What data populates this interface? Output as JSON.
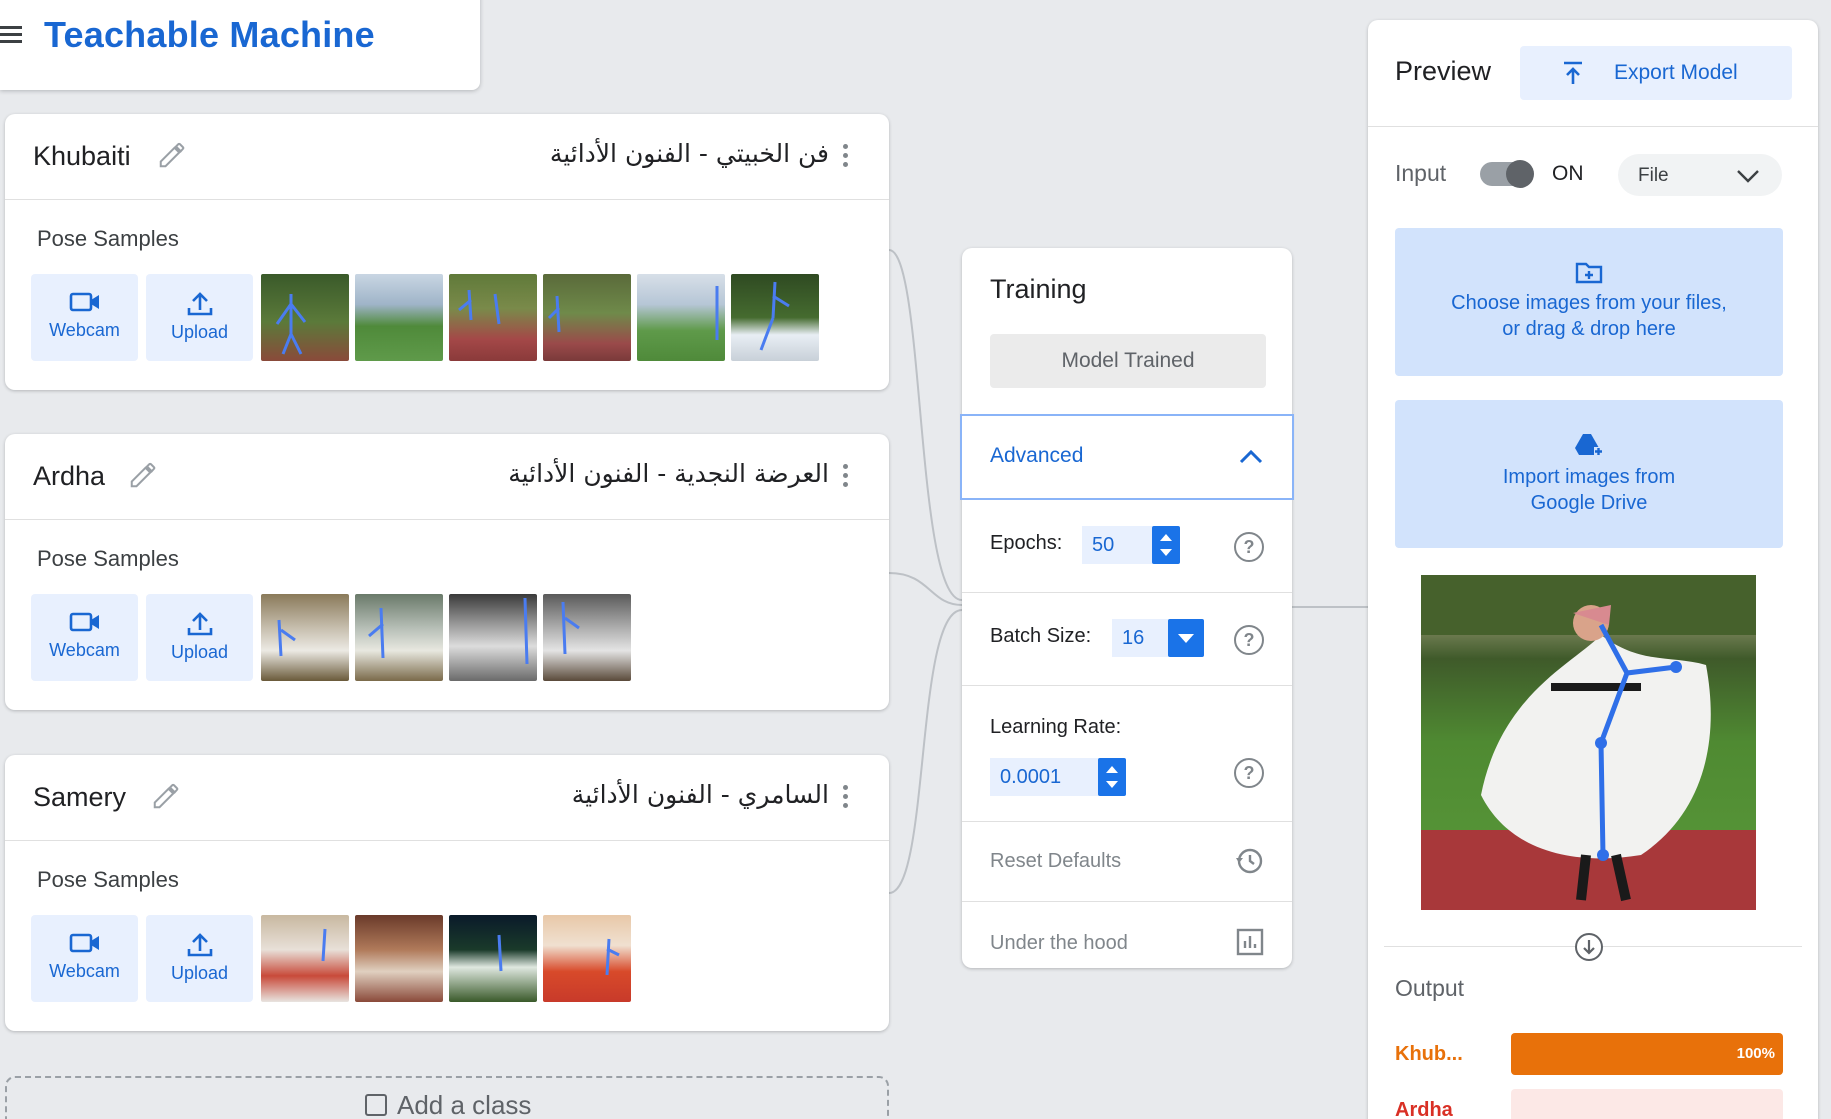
{
  "app": {
    "title": "Teachable Machine"
  },
  "classes": [
    {
      "name": "Khubaiti",
      "arabic": "فن الخبيتي - الفنون الأدائية",
      "samples_label": "Pose Samples",
      "webcam_label": "Webcam",
      "upload_label": "Upload",
      "thumb_count": 6
    },
    {
      "name": "Ardha",
      "arabic": "العرضة النجدية - الفنون الأدائية",
      "samples_label": "Pose Samples",
      "webcam_label": "Webcam",
      "upload_label": "Upload",
      "thumb_count": 4
    },
    {
      "name": "Samery",
      "arabic": "السامري - الفنون الأدائية",
      "samples_label": "Pose Samples",
      "webcam_label": "Webcam",
      "upload_label": "Upload",
      "thumb_count": 4
    }
  ],
  "add_class": {
    "label": "Add a class"
  },
  "training": {
    "title": "Training",
    "button_label": "Model Trained",
    "advanced_label": "Advanced",
    "epochs_label": "Epochs:",
    "epochs_value": "50",
    "batch_label": "Batch Size:",
    "batch_value": "16",
    "lr_label": "Learning Rate:",
    "lr_value": "0.0001",
    "reset_label": "Reset Defaults",
    "hood_label": "Under the hood",
    "help_glyph": "?"
  },
  "preview": {
    "title": "Preview",
    "export_label": "Export Model",
    "input_label": "Input",
    "toggle_state": "ON",
    "source_select": "File",
    "choose_files_line1": "Choose images from your files,",
    "choose_files_line2": "or drag & drop here",
    "drive_line1": "Import images from",
    "drive_line2": "Google Drive",
    "output_label": "Output",
    "outputs": [
      {
        "label": "Khub...",
        "percent": 1.0,
        "percent_label": "100%",
        "color": "#e8710a",
        "track": "#fce8d8"
      },
      {
        "label": "Ardha",
        "percent": 0.0,
        "percent_label": "",
        "color": "#d93025",
        "track": "#fce8e6"
      }
    ]
  },
  "colors": {
    "accent": "#1967d2",
    "accent_light": "#e8f0fe",
    "background": "#e8eaed"
  }
}
